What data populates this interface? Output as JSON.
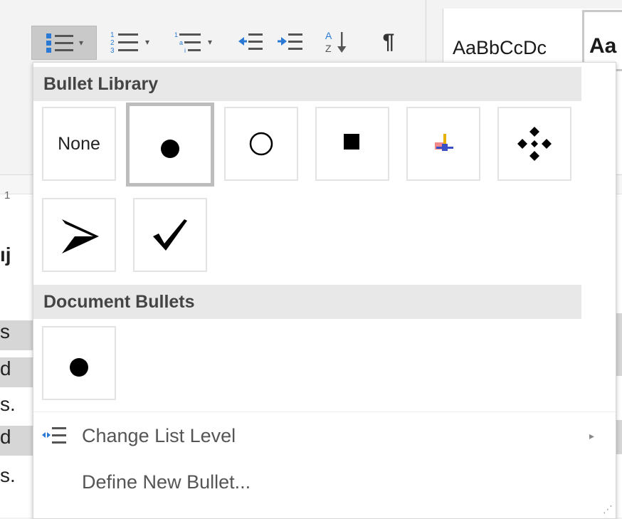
{
  "ribbon": {
    "styles": {
      "normal_sample": "AaBbCcDc",
      "heading_sample": "Aa"
    }
  },
  "document": {
    "ruler_number": "1",
    "fragments": [
      "ıj",
      "s",
      "d",
      "s.",
      "d",
      "s."
    ]
  },
  "menu": {
    "bullet_library": {
      "title": "Bullet Library",
      "items": [
        "None",
        "filled-circle",
        "hollow-circle",
        "filled-square",
        "star-cross",
        "diamond-cluster",
        "arrowhead",
        "checkmark"
      ],
      "none_label": "None",
      "selected_index": 1
    },
    "document_bullets": {
      "title": "Document Bullets",
      "items": [
        "filled-circle"
      ]
    },
    "change_list_level": "Change List Level",
    "define_new_bullet": "Define New Bullet..."
  },
  "colors": {
    "selection": "#c9c9c9",
    "section_header": "#e8e8e8",
    "accent_blue": "#2a7ad5"
  }
}
